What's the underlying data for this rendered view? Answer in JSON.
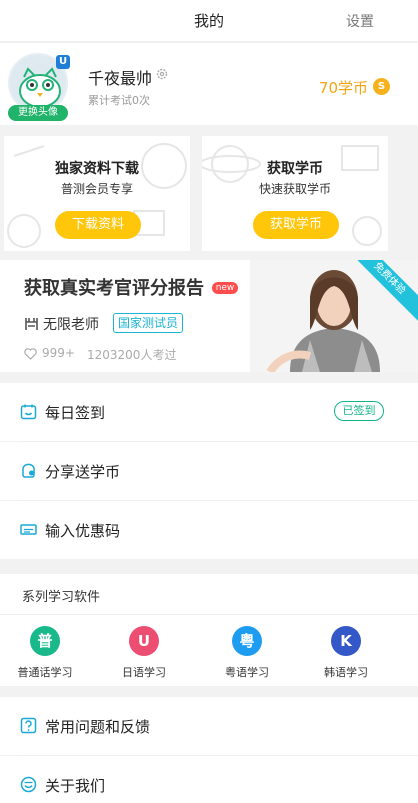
{
  "nav": {
    "title": "我的",
    "settings_label": "设置"
  },
  "profile": {
    "avatar_badge": "U",
    "change_avatar_label": "更换头像",
    "username": "千夜最帅",
    "exam_count": "累计考试0次",
    "coins": "70学币",
    "coin_icon": "S"
  },
  "promos": [
    {
      "title": "独家资料下载",
      "subtitle": "普测会员专享",
      "button": "下载资料"
    },
    {
      "title": "获取学币",
      "subtitle": "快速获取学币",
      "button": "获取学币"
    }
  ],
  "banner": {
    "title": "获取真实考官评分报告",
    "new_badge": "new",
    "teacher": "无限老师",
    "tester_tag": "国家测试员",
    "likes": "999+",
    "examinees": "1203200人考过",
    "ribbon": "免费体验"
  },
  "menu": {
    "checkin": {
      "label": "每日签到",
      "status": "已签到"
    },
    "share": {
      "label": "分享送学币"
    },
    "coupon": {
      "label": "输入优惠码"
    },
    "faq": {
      "label": "常用问题和反馈"
    },
    "about": {
      "label": "关于我们"
    }
  },
  "apps": {
    "title": "系列学习软件",
    "items": [
      {
        "label": "普通话学习",
        "icon_char": "普",
        "color": "#19b98b"
      },
      {
        "label": "日语学习",
        "icon_char": "U",
        "color": "#ee4d72"
      },
      {
        "label": "粤语学习",
        "icon_char": "粤",
        "color": "#1e9df0"
      },
      {
        "label": "韩语学习",
        "icon_char": "K",
        "color": "#3558c9"
      }
    ]
  },
  "colors": {
    "accent_yellow": "#ffc60a",
    "coin_orange": "#f5a30f",
    "green": "#12b58a",
    "teal": "#1ab3d6"
  }
}
